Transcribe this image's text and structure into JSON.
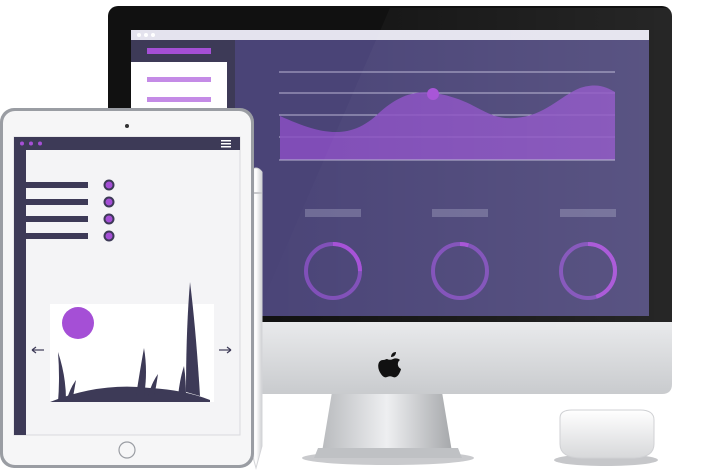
{
  "colors": {
    "accent": "#a54fd6",
    "accent_light": "#c48be6",
    "screen_bg": "#4a4477",
    "dark_navy": "#3d3a57",
    "bezel": "#111111",
    "silver": "#d9dadc",
    "tablet_frame": "#9a9da3"
  },
  "icons": {
    "menu": "hamburger-menu-icon",
    "logo": "apple-logo-icon",
    "left": "arrow-left-icon",
    "right": "arrow-right-icon",
    "sun": "circle-sun-icon",
    "grass": "grass-silhouette-icon"
  },
  "desktop": {
    "ring_progress": [
      0.25,
      0.05,
      0.45
    ]
  },
  "tablet": {
    "list_item_count": 4,
    "carousel_arrows": [
      "left",
      "right"
    ]
  }
}
